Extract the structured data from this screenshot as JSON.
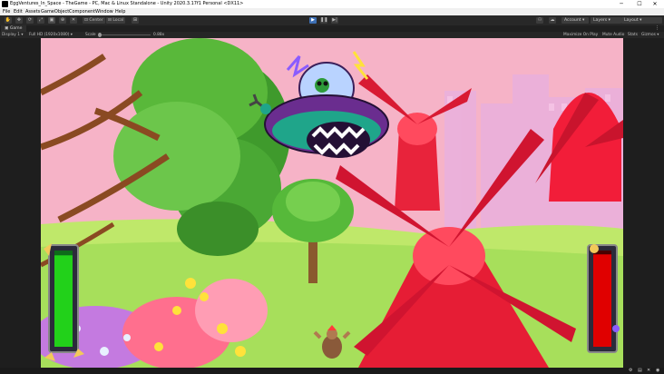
{
  "window": {
    "title": "EggVentures_In_Space - TheGame - PC, Mac & Linux Standalone - Unity 2020.3.17f1 Personal <DX11>",
    "controls": [
      "─",
      "☐",
      "✕"
    ]
  },
  "menu": [
    "File",
    "Edit",
    "Assets",
    "GameObject",
    "Component",
    "Window",
    "Help"
  ],
  "toolbar": {
    "pivot_label": "Center",
    "space_label": "Local",
    "account_label": "Account",
    "layers_label": "Layers",
    "layout_label": "Layout"
  },
  "game_view": {
    "tab_label": "Game",
    "display_label": "Display 1",
    "resolution_label": "Full HD (1920x1080)",
    "scale_label": "Scale",
    "scale_value": "0.88x",
    "options": [
      "Maximize On Play",
      "Mute Audio",
      "Stats",
      "Gizmos"
    ]
  },
  "hud": {
    "player_health": 0.95,
    "boss_health": 0.96,
    "player_bar_color": "#22d11a",
    "boss_bar_color": "#e00000"
  },
  "colors": {
    "sky": "#f6b3c7",
    "grass": "#bfe86a",
    "windmill": "#e8233b",
    "ufo": "#6a2d8f",
    "ufo_ring": "#1fa58a"
  }
}
